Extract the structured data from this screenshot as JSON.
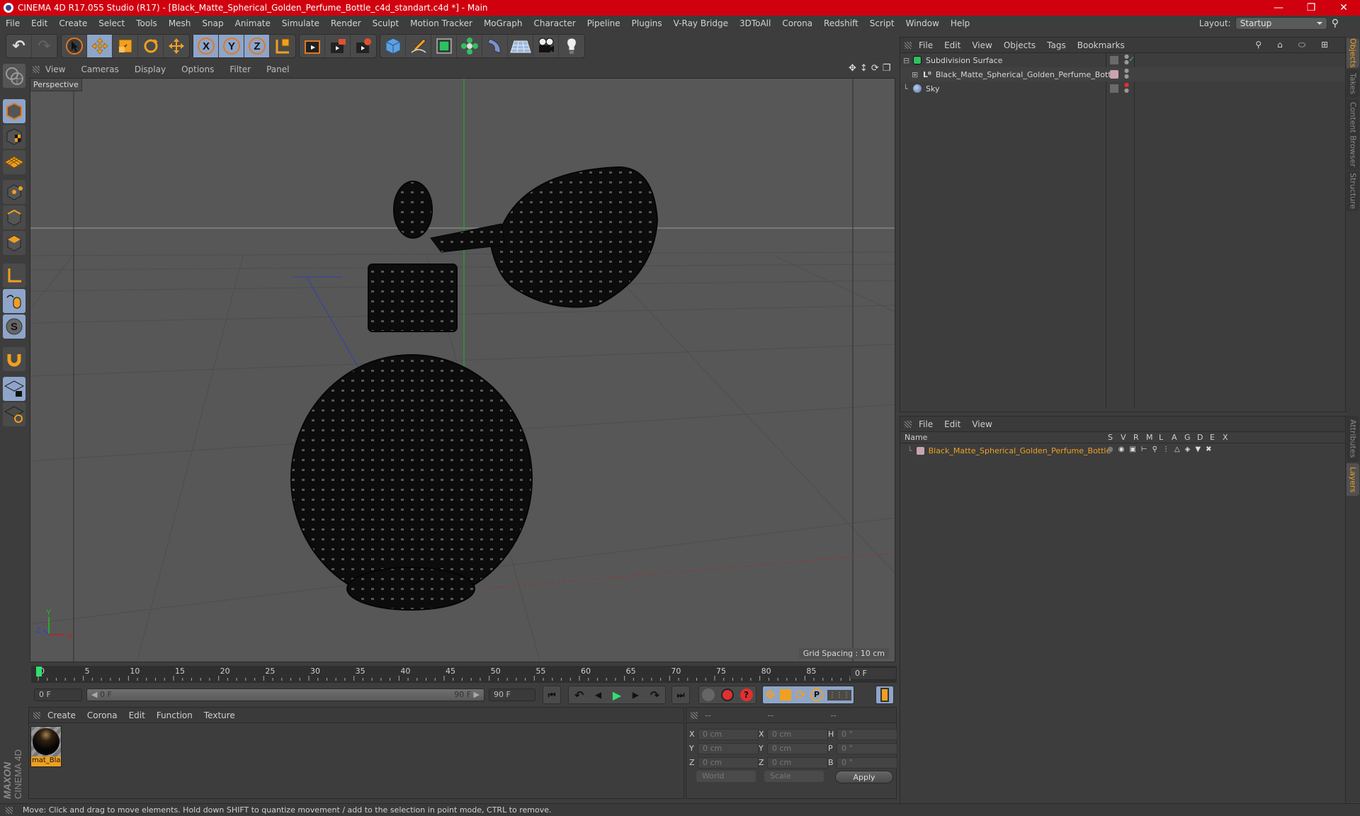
{
  "window": {
    "title": "CINEMA 4D R17.055 Studio (R17) - [Black_Matte_Spherical_Golden_Perfume_Bottle_c4d_standart.c4d *] - Main",
    "controls": [
      "minimize",
      "restore",
      "close"
    ]
  },
  "menubar": [
    "File",
    "Edit",
    "Create",
    "Select",
    "Tools",
    "Mesh",
    "Snap",
    "Animate",
    "Simulate",
    "Render",
    "Sculpt",
    "Motion Tracker",
    "MoGraph",
    "Character",
    "Pipeline",
    "Plugins",
    "V-Ray Bridge",
    "3DToAll",
    "Corona",
    "Redshift",
    "Script",
    "Window",
    "Help"
  ],
  "layout": {
    "label": "Layout:",
    "value": "Startup"
  },
  "toolbar": {
    "groups": [
      [
        "undo-icon",
        "redo-icon"
      ],
      [
        "select-arrow-icon",
        "move-icon",
        "scale-icon",
        "rotate-icon",
        "transform-icon"
      ],
      [
        "x-axis-icon",
        "y-axis-icon",
        "z-axis-icon",
        "world-coordinates-icon"
      ],
      [
        "render-view-icon",
        "render-picture-viewer-icon",
        "render-settings-icon"
      ],
      [
        "cube-icon",
        "pen-spline-icon",
        "subdivision-icon",
        "cloner-icon",
        "deformer-icon",
        "floor-icon",
        "camera-icon",
        "light-icon"
      ]
    ],
    "active": [
      "move-icon",
      "x-axis-icon",
      "y-axis-icon",
      "z-axis-icon"
    ]
  },
  "left_tools": [
    "make-editable-icon",
    "model-mode-icon",
    "texture-mode-icon",
    "workplane-mode-icon",
    "points-mode-icon",
    "edges-mode-icon",
    "polygons-mode-icon",
    "axis-mode-icon",
    "tweak-mode-icon",
    "solo-icon",
    "snap-magnet-icon",
    "lock-workplane-icon",
    "workplane-sync-icon"
  ],
  "viewport": {
    "menu": [
      "View",
      "Cameras",
      "Display",
      "Options",
      "Filter",
      "Panel"
    ],
    "camera_label": "Perspective",
    "grid_spacing": "Grid Spacing : 10 cm",
    "axis": {
      "x": "X",
      "y": "Y",
      "z": "Z"
    },
    "nav_icons": [
      "pan-icon",
      "dolly-icon",
      "orbit-icon",
      "maximize-view-icon"
    ]
  },
  "objects_panel": {
    "menu": [
      "File",
      "Edit",
      "View",
      "Objects",
      "Tags",
      "Bookmarks"
    ],
    "items": [
      {
        "name": "Subdivision Surface",
        "icon": "subdivision-icon",
        "level": 0,
        "check": "✓"
      },
      {
        "name": "Black_Matte_Spherical_Golden_Perfume_Bottle",
        "icon": "null-object-icon",
        "level": 1,
        "tag_color": "#c9a4b0"
      },
      {
        "name": "Sky",
        "icon": "sky-icon",
        "level": 0
      }
    ]
  },
  "side_tabs": {
    "top": [
      {
        "label": "Objects",
        "active": true
      },
      {
        "label": "Takes",
        "active": false
      },
      {
        "label": "Content Browser",
        "active": false
      },
      {
        "label": "Structure",
        "active": false
      }
    ],
    "bottom": [
      {
        "label": "Attributes",
        "active": false
      },
      {
        "label": "Layers",
        "active": true
      }
    ]
  },
  "layers_panel": {
    "menu": [
      "File",
      "Edit",
      "View"
    ],
    "columns": [
      "Name",
      "S",
      "V",
      "R",
      "M",
      "L",
      "A",
      "G",
      "D",
      "E",
      "X"
    ],
    "rows": [
      {
        "name": "Black_Matte_Spherical_Golden_Perfume_Bottle",
        "color": "#c9a4b0"
      }
    ]
  },
  "timeline": {
    "ticks": [
      "0",
      "5",
      "10",
      "15",
      "20",
      "25",
      "30",
      "35",
      "40",
      "45",
      "50",
      "55",
      "60",
      "65",
      "70",
      "75",
      "80",
      "85",
      "90"
    ],
    "current_frame": "0 F",
    "start_field": "0 F",
    "range_start": "0 F",
    "range_end": "90 F",
    "end_field": "90 F"
  },
  "material_panel": {
    "menu": [
      "Create",
      "Corona",
      "Edit",
      "Function",
      "Texture"
    ],
    "materials": [
      {
        "name": "mat_Bla"
      }
    ]
  },
  "coord_panel": {
    "headers": [
      "--",
      "--",
      "--"
    ],
    "rows": [
      {
        "l1": "X",
        "v1": "0 cm",
        "l2": "X",
        "v2": "0 cm",
        "l3": "H",
        "v3": "0 °"
      },
      {
        "l1": "Y",
        "v1": "0 cm",
        "l2": "Y",
        "v2": "0 cm",
        "l3": "P",
        "v3": "0 °"
      },
      {
        "l1": "Z",
        "v1": "0 cm",
        "l2": "Z",
        "v2": "0 cm",
        "l3": "B",
        "v3": "0 °"
      }
    ],
    "space": "World",
    "mode": "Scale",
    "apply": "Apply"
  },
  "status": "Move: Click and drag to move elements. Hold down SHIFT to quantize movement / add to the selection in point mode, CTRL to remove.",
  "branding": {
    "maxon": "MAXON",
    "product": "CINEMA 4D"
  },
  "colors": {
    "title_bar": "#d0000f",
    "accent_orange": "#f0a020",
    "active_button": "#8ea5c9",
    "viewport_bg": "#575757"
  }
}
